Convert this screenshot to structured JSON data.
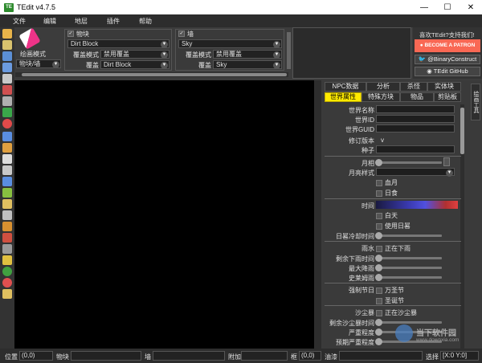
{
  "window": {
    "title": "TEdit v4.7.5",
    "icon_text": "TE"
  },
  "menu": [
    "文件",
    "编辑",
    "地层",
    "插件",
    "帮助"
  ],
  "brush": {
    "label": "绘画模式",
    "select_value": "物块/墙"
  },
  "tile": {
    "header": "物块",
    "value": "Dirt Block",
    "mask_mode_label": "覆盖模式",
    "mask_mode_value": "禁用覆盖",
    "mask_label": "覆盖",
    "mask_value": "Dirt Block"
  },
  "wall": {
    "header": "墙",
    "value": "Sky",
    "mask_mode_label": "覆盖模式",
    "mask_mode_value": "禁用覆盖",
    "mask_label": "覆盖",
    "mask_value": "Sky"
  },
  "support": {
    "text": "喜欢TEdit?支持我们!",
    "patreon": "BECOME A PATRON",
    "twitter": "@BinaryConstruct",
    "github": "TEdit GitHub"
  },
  "tabs_row1": [
    "NPC数据",
    "分析",
    "杀怪",
    "实体块"
  ],
  "tabs_row2": [
    "世界属性",
    "特殊方块",
    "物品",
    "剪贴板"
  ],
  "side_tab": "绘画工具",
  "props": {
    "world_name": "世界名称",
    "world_id": "世界ID",
    "world_guid": "世界GUID",
    "revision": "修订版本",
    "revision_value": "v",
    "seed": "种子",
    "moon_phase": "月相",
    "moon_style": "月亮样式",
    "blood_moon": "血月",
    "eclipse": "日食",
    "time": "时间",
    "daytime": "白天",
    "use_sundial": "使用日晷",
    "sundial_cooldown": "日晷冷却时间",
    "rain": "雨水",
    "is_raining": "正在下雨",
    "rain_time_left": "剩余下雨时间",
    "max_rain": "最大降雨",
    "slime_rain": "史莱姆雨",
    "forced_holiday": "强制节日",
    "halloween": "万圣节",
    "christmas": "圣诞节",
    "sandstorm": "沙尘暴",
    "is_sandstorm": "正在沙尘暴",
    "sandstorm_time_left": "剩余沙尘暴时间",
    "severity": "严重程度",
    "intended_severity": "预期严重程度"
  },
  "status": {
    "position_label": "位置",
    "position_value": "(0,0)",
    "tile_label": "物块",
    "wall_label": "墙",
    "extra_label": "附加",
    "frame_label": "框",
    "frame_value": "(0,0)",
    "liquid_label": "油漆",
    "selection_label": "选择",
    "selection_value": "[X:0 Y:0]"
  },
  "watermark": {
    "line1": "当下软件园",
    "line2": "www.downxia.com"
  },
  "colors": {
    "patreon": "#f96854",
    "active_tab": "#ffea00",
    "canvas": "#000000"
  }
}
